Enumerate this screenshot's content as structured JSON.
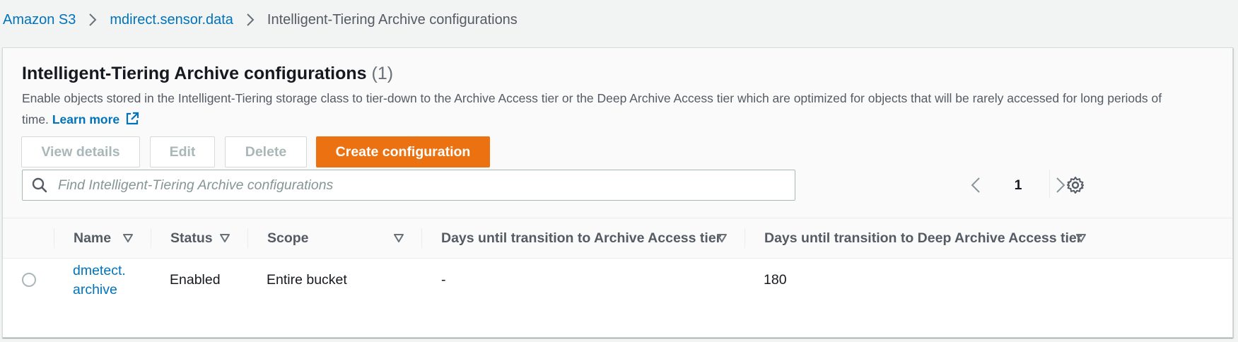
{
  "breadcrumb": {
    "items": [
      "Amazon S3",
      "mdirect.sensor.data"
    ],
    "current": "Intelligent-Tiering Archive configurations"
  },
  "panel": {
    "title": "Intelligent-Tiering Archive configurations",
    "count": "(1)",
    "description": "Enable objects stored in the Intelligent-Tiering storage class to tier-down to the Archive Access tier or the Deep Archive Access tier which are optimized for objects that will be rarely accessed for long periods of time.",
    "learn_more": "Learn more"
  },
  "actions": {
    "view_details": "View details",
    "edit": "Edit",
    "delete": "Delete",
    "create": "Create configuration"
  },
  "search": {
    "placeholder": "Find Intelligent-Tiering Archive configurations",
    "value": ""
  },
  "pagination": {
    "current_page": "1"
  },
  "table": {
    "columns": [
      "Name",
      "Status",
      "Scope",
      "Days until transition to Archive Access tier",
      "Days until transition to Deep Archive Access tier"
    ],
    "rows": [
      {
        "name_line1": "dmetect.",
        "name_line2": "archive",
        "status": "Enabled",
        "scope": "Entire bucket",
        "archive_days": "-",
        "deep_archive_days": "180"
      }
    ]
  },
  "colors": {
    "link": "#0073bb",
    "primary_button": "#ec7211",
    "disabled_text": "#aab7b8",
    "heading": "#16191f",
    "secondary_text": "#545b64"
  },
  "icons": [
    "chevron-right-icon",
    "external-link-icon",
    "search-icon",
    "chevron-left-icon",
    "gear-icon",
    "sort-caret-icon",
    "radio-icon"
  ]
}
